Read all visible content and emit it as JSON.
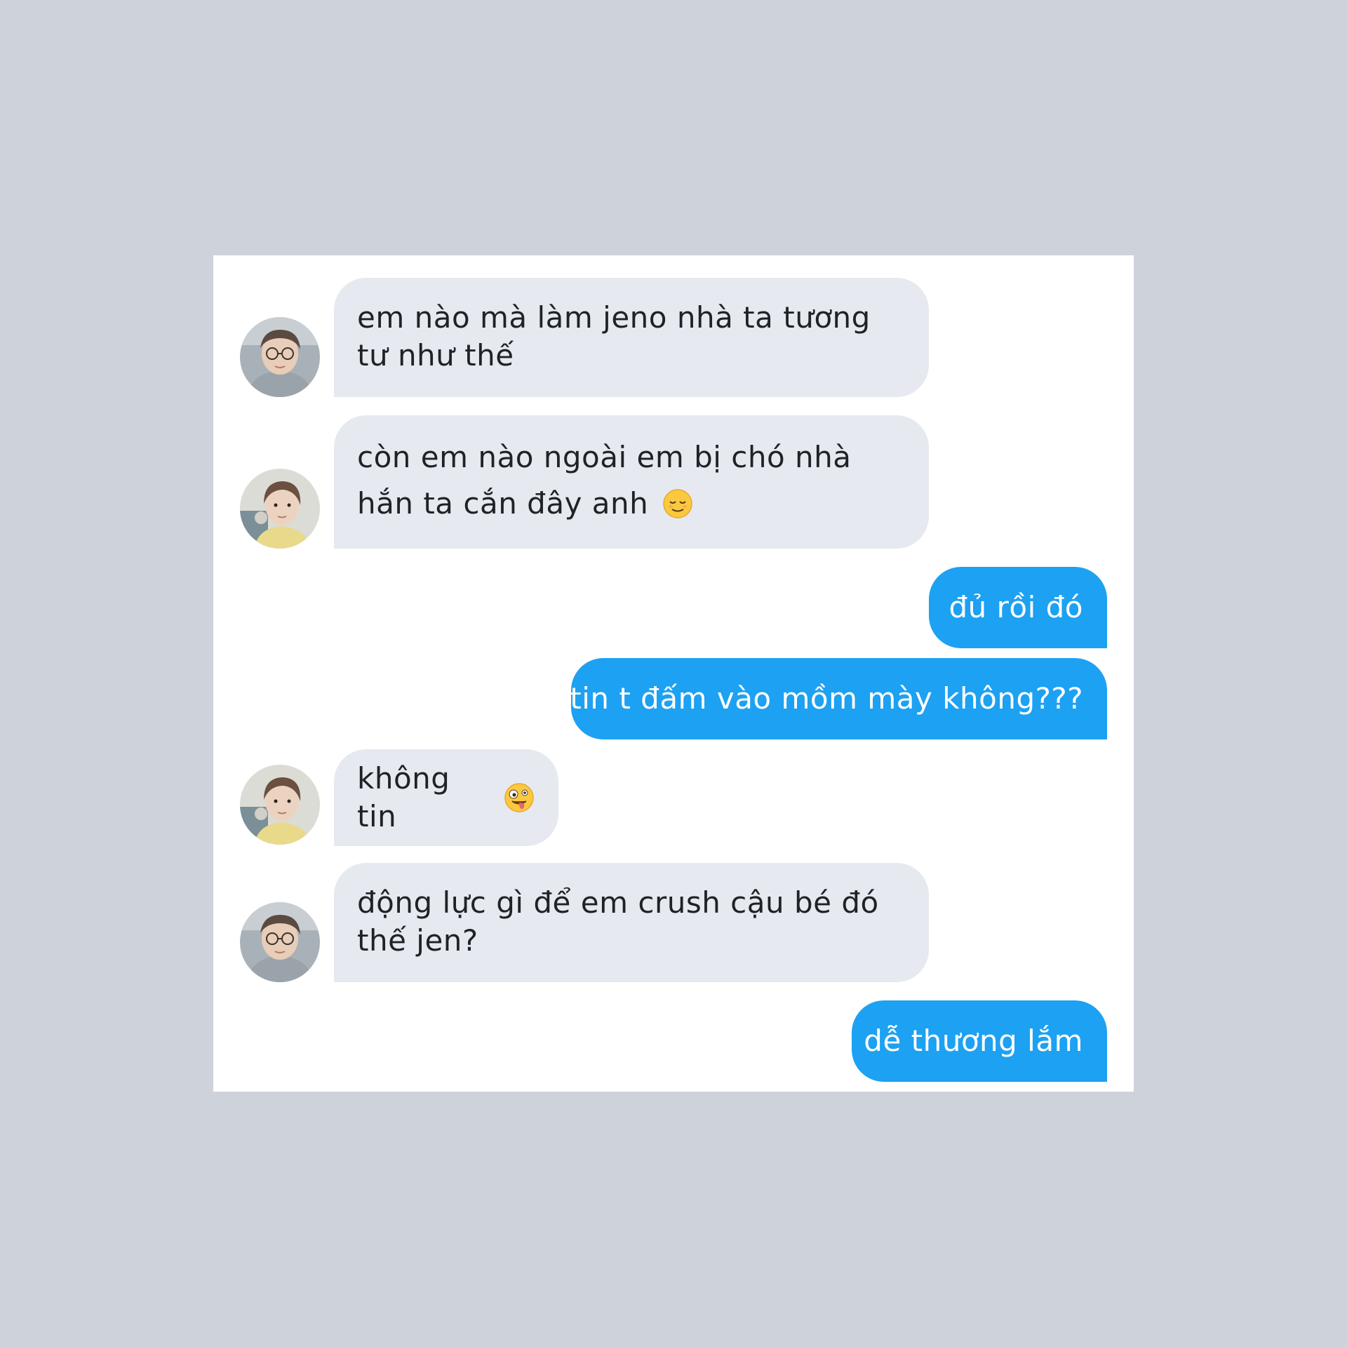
{
  "conversation": {
    "messages": [
      {
        "direction": "incoming",
        "avatar": "avatar-glasses",
        "text": "em nào mà làm jeno nhà ta tương tư như thế"
      },
      {
        "direction": "incoming",
        "avatar": "avatar-selfie",
        "text": "còn em nào ngoài em bị chó nhà hắn ta cắn đây anh",
        "emoji": "relieved-face"
      },
      {
        "direction": "outgoing",
        "text": "đủ rồi đó"
      },
      {
        "direction": "outgoing",
        "text": "tin t đấm vào mồm mày không???"
      },
      {
        "direction": "incoming",
        "avatar": "avatar-selfie",
        "text": "không tin",
        "emoji": "zany-face"
      },
      {
        "direction": "incoming",
        "avatar": "avatar-glasses",
        "text": "động lực gì để em crush cậu bé đó thế jen?"
      },
      {
        "direction": "outgoing",
        "text": "dễ thương lắm"
      }
    ]
  },
  "colors": {
    "background": "#ced2da",
    "panel": "#ffffff",
    "incoming_bubble": "#e6e9ef",
    "outgoing_bubble": "#1da1f2",
    "incoming_text": "#1f2328",
    "outgoing_text": "#ffffff"
  }
}
